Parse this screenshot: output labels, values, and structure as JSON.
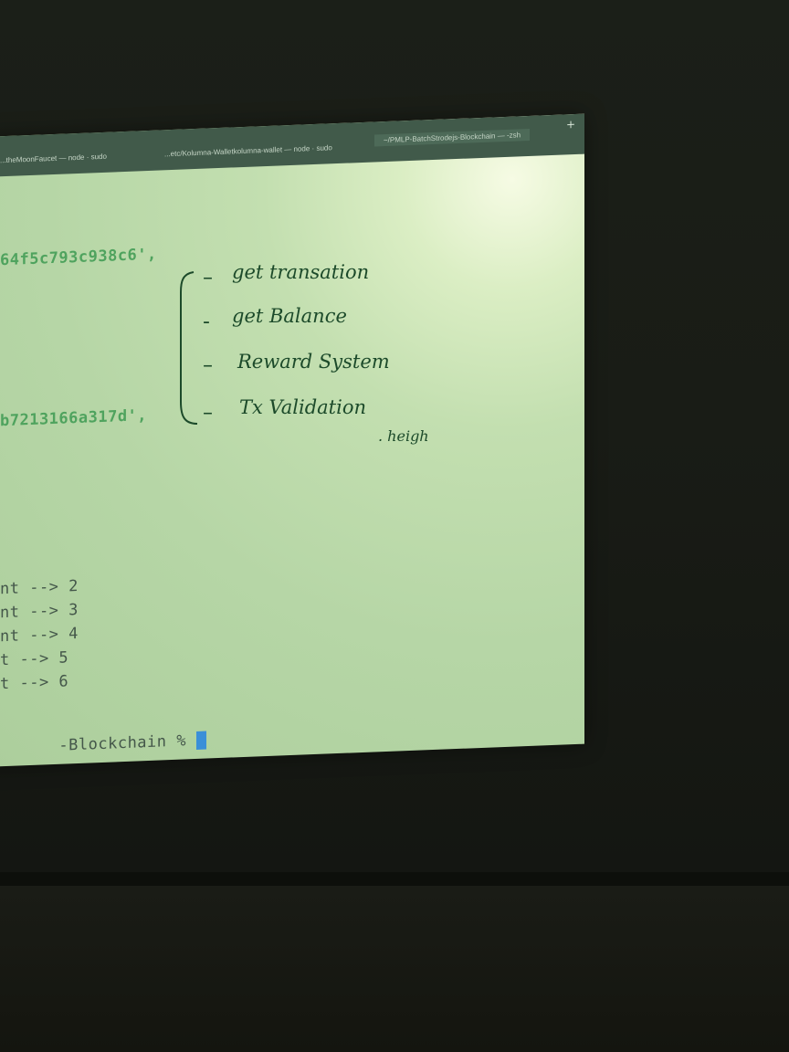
{
  "tabs": [
    {
      "label": "...theMoonFaucet — node · sudo"
    },
    {
      "label": "...etc/Kolumna-Walletkolumna-wallet — node · sudo"
    },
    {
      "label": "~/PMLP-BatchStrodejs-Blockchain — -zsh"
    }
  ],
  "new_tab_label": "+",
  "terminal": {
    "hash_line_1": "64f5c793c938c6',",
    "hash_line_2": "b7213166a317d',",
    "output_lines": [
      "nt --> 2",
      "nt --> 3",
      "nt --> 4",
      "t --> 5",
      "t --> 6"
    ],
    "prompt": "-Blockchain % "
  },
  "handwritten_notes": {
    "items": [
      "get transation",
      "get Balance",
      "Reward System",
      "Tx Validation"
    ],
    "extra": ". heigh"
  },
  "colors": {
    "screen_bg": "#b6d6a6",
    "hash_green": "#4fa35e",
    "prompt_text": "#44574a",
    "cursor": "#3a8fd8",
    "ink": "#1c4a2a"
  }
}
